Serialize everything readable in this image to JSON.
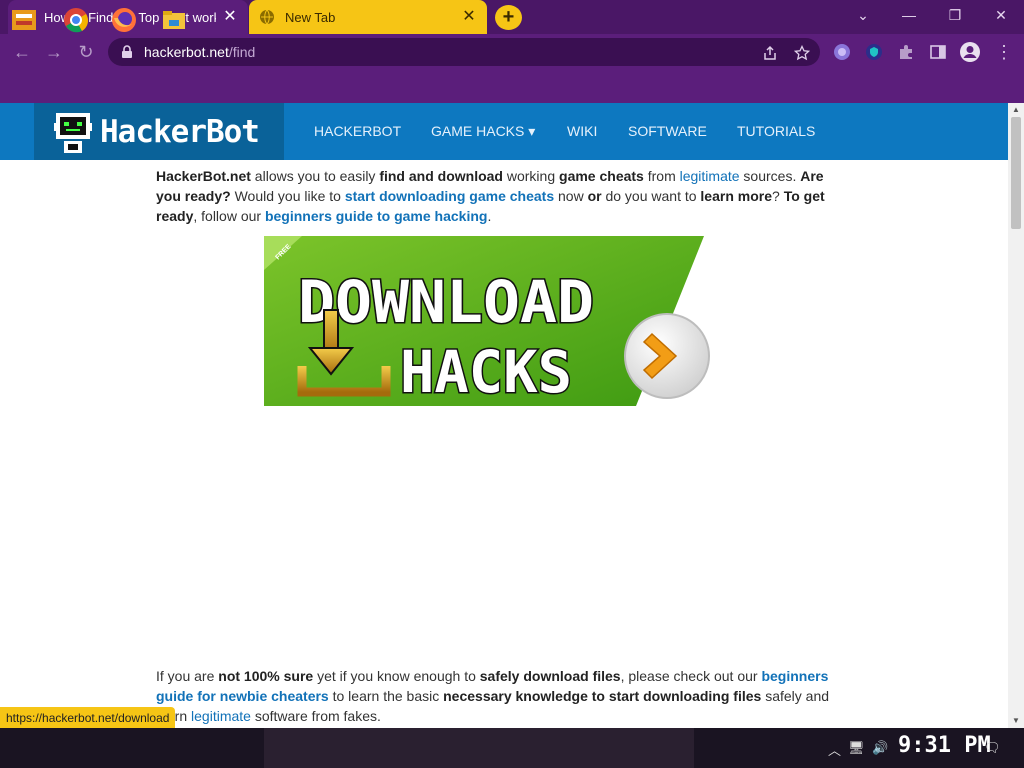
{
  "browser": {
    "tabs": [
      {
        "title": "How to Find the Top Best work",
        "close": "✕"
      },
      {
        "title": "New Tab",
        "close": "✕"
      }
    ],
    "new_tab": "+",
    "url_host": "hackerbot.net",
    "url_path": "/find",
    "window_controls": [
      "⌄",
      "—",
      "❐",
      "✕"
    ],
    "status_url": "https://hackerbot.net/download"
  },
  "site": {
    "logo": "HackerBot",
    "nav": [
      "HACKERBOT",
      "GAME HACKS ▾",
      "WIKI",
      "SOFTWARE",
      "TUTORIALS"
    ]
  },
  "intro": {
    "p1": "HackerBot.net",
    "p2": " allows you to easily ",
    "p3": "find and download",
    "p4": " working ",
    "p5": "game cheats",
    "p6": " from ",
    "p7": "legitimate",
    "p8": " sources. ",
    "p9": "Are you ready?",
    "p10": " Would you like to ",
    "p11": "start downloading game cheats",
    "p12": " now ",
    "p13": "or",
    "p14": " do you want to ",
    "p15": "learn more",
    "p16": "? ",
    "p17": "To get ready",
    "p18": ", follow our ",
    "p19": "beginners guide to game hacking",
    "p20": "."
  },
  "banner": {
    "badge": "FREE",
    "line1": "DOWNLOAD",
    "line2": "HACKS"
  },
  "second": {
    "s1": "If you are ",
    "s2": "not 100% sure",
    "s3": " yet if you know enough to ",
    "s4": "safely download files",
    "s5": ", please check out our ",
    "s6": "beginners guide for newbie cheaters",
    "s7": " to learn the basic ",
    "s8": "necessary knowledge to start downloading files",
    "s9": " safely and ",
    "s10": "learn",
    "s11": " ",
    "s12": "legitimate",
    "s13": " software from fakes."
  },
  "taskbar": {
    "clock": "9:31 PM"
  },
  "colors": {
    "chrome_purple": "#5b1e7b",
    "tab_yellow": "#f6c515",
    "site_blue": "#0d78c0",
    "link_blue": "#1272b8",
    "banner_green": "#5cae1e"
  }
}
